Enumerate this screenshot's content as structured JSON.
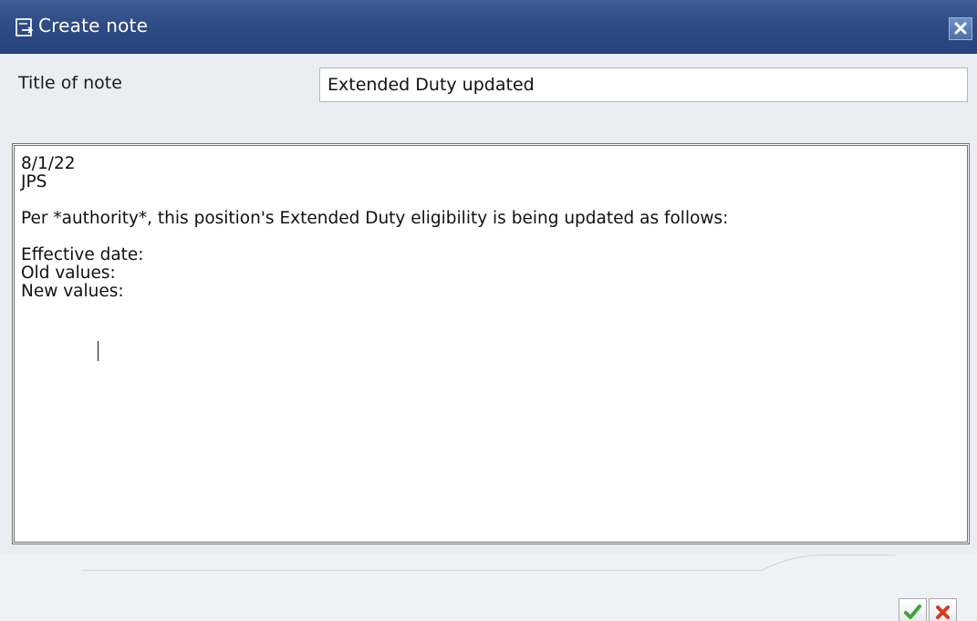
{
  "window": {
    "title": "Create note"
  },
  "form": {
    "title_label": "Title of note",
    "title_value": "Extended Duty updated"
  },
  "note": {
    "body_lines": [
      "8/1/22",
      "JPS",
      "",
      "Per *authority*, this position's Extended Duty eligibility is being updated as follows:",
      "",
      "Effective date:",
      "Old values:",
      "New values:"
    ]
  },
  "icons": {
    "title_icon": "edit-note-icon",
    "close_icon": "close-icon",
    "confirm_icon": "checkmark-icon",
    "cancel_icon": "cancel-icon"
  },
  "colors": {
    "titlebar": "#2e4c85",
    "confirm": "#3aa532",
    "cancel": "#d83b1d"
  }
}
